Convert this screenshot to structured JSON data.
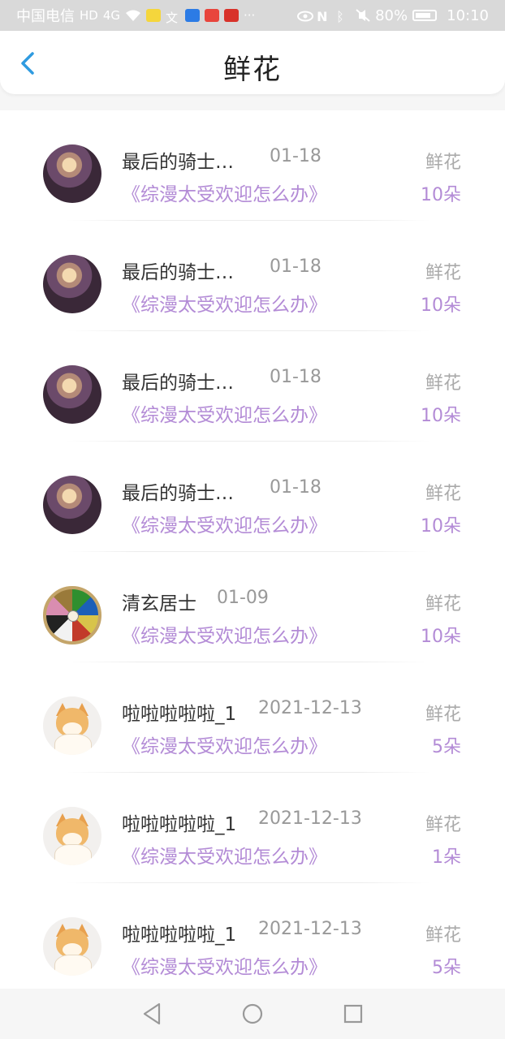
{
  "status_bar": {
    "carrier": "中国电信",
    "hd": "HD",
    "network": "4G",
    "more": "···",
    "battery_percent": "80%",
    "time": "10:10"
  },
  "header": {
    "title": "鲜花"
  },
  "colors": {
    "accent": "#b38bd6",
    "back": "#2f9be0"
  },
  "records": [
    {
      "avatar": "knight",
      "name": "最后的骑士…",
      "date": "01-18",
      "book": "《综漫太受欢迎怎么办》",
      "gift": "鲜花",
      "count": "10朵"
    },
    {
      "avatar": "knight",
      "name": "最后的骑士…",
      "date": "01-18",
      "book": "《综漫太受欢迎怎么办》",
      "gift": "鲜花",
      "count": "10朵"
    },
    {
      "avatar": "knight",
      "name": "最后的骑士…",
      "date": "01-18",
      "book": "《综漫太受欢迎怎么办》",
      "gift": "鲜花",
      "count": "10朵"
    },
    {
      "avatar": "knight",
      "name": "最后的骑士…",
      "date": "01-18",
      "book": "《综漫太受欢迎怎么办》",
      "gift": "鲜花",
      "count": "10朵"
    },
    {
      "avatar": "wheel",
      "name": "清玄居士",
      "date": "01-09",
      "book": "《综漫太受欢迎怎么办》",
      "gift": "鲜花",
      "count": "10朵"
    },
    {
      "avatar": "dog",
      "name": "啦啦啦啦啦_1",
      "date": "2021-12-13",
      "book": "《综漫太受欢迎怎么办》",
      "gift": "鲜花",
      "count": "5朵"
    },
    {
      "avatar": "dog",
      "name": "啦啦啦啦啦_1",
      "date": "2021-12-13",
      "book": "《综漫太受欢迎怎么办》",
      "gift": "鲜花",
      "count": "1朵"
    },
    {
      "avatar": "dog",
      "name": "啦啦啦啦啦_1",
      "date": "2021-12-13",
      "book": "《综漫太受欢迎怎么办》",
      "gift": "鲜花",
      "count": "5朵"
    }
  ]
}
